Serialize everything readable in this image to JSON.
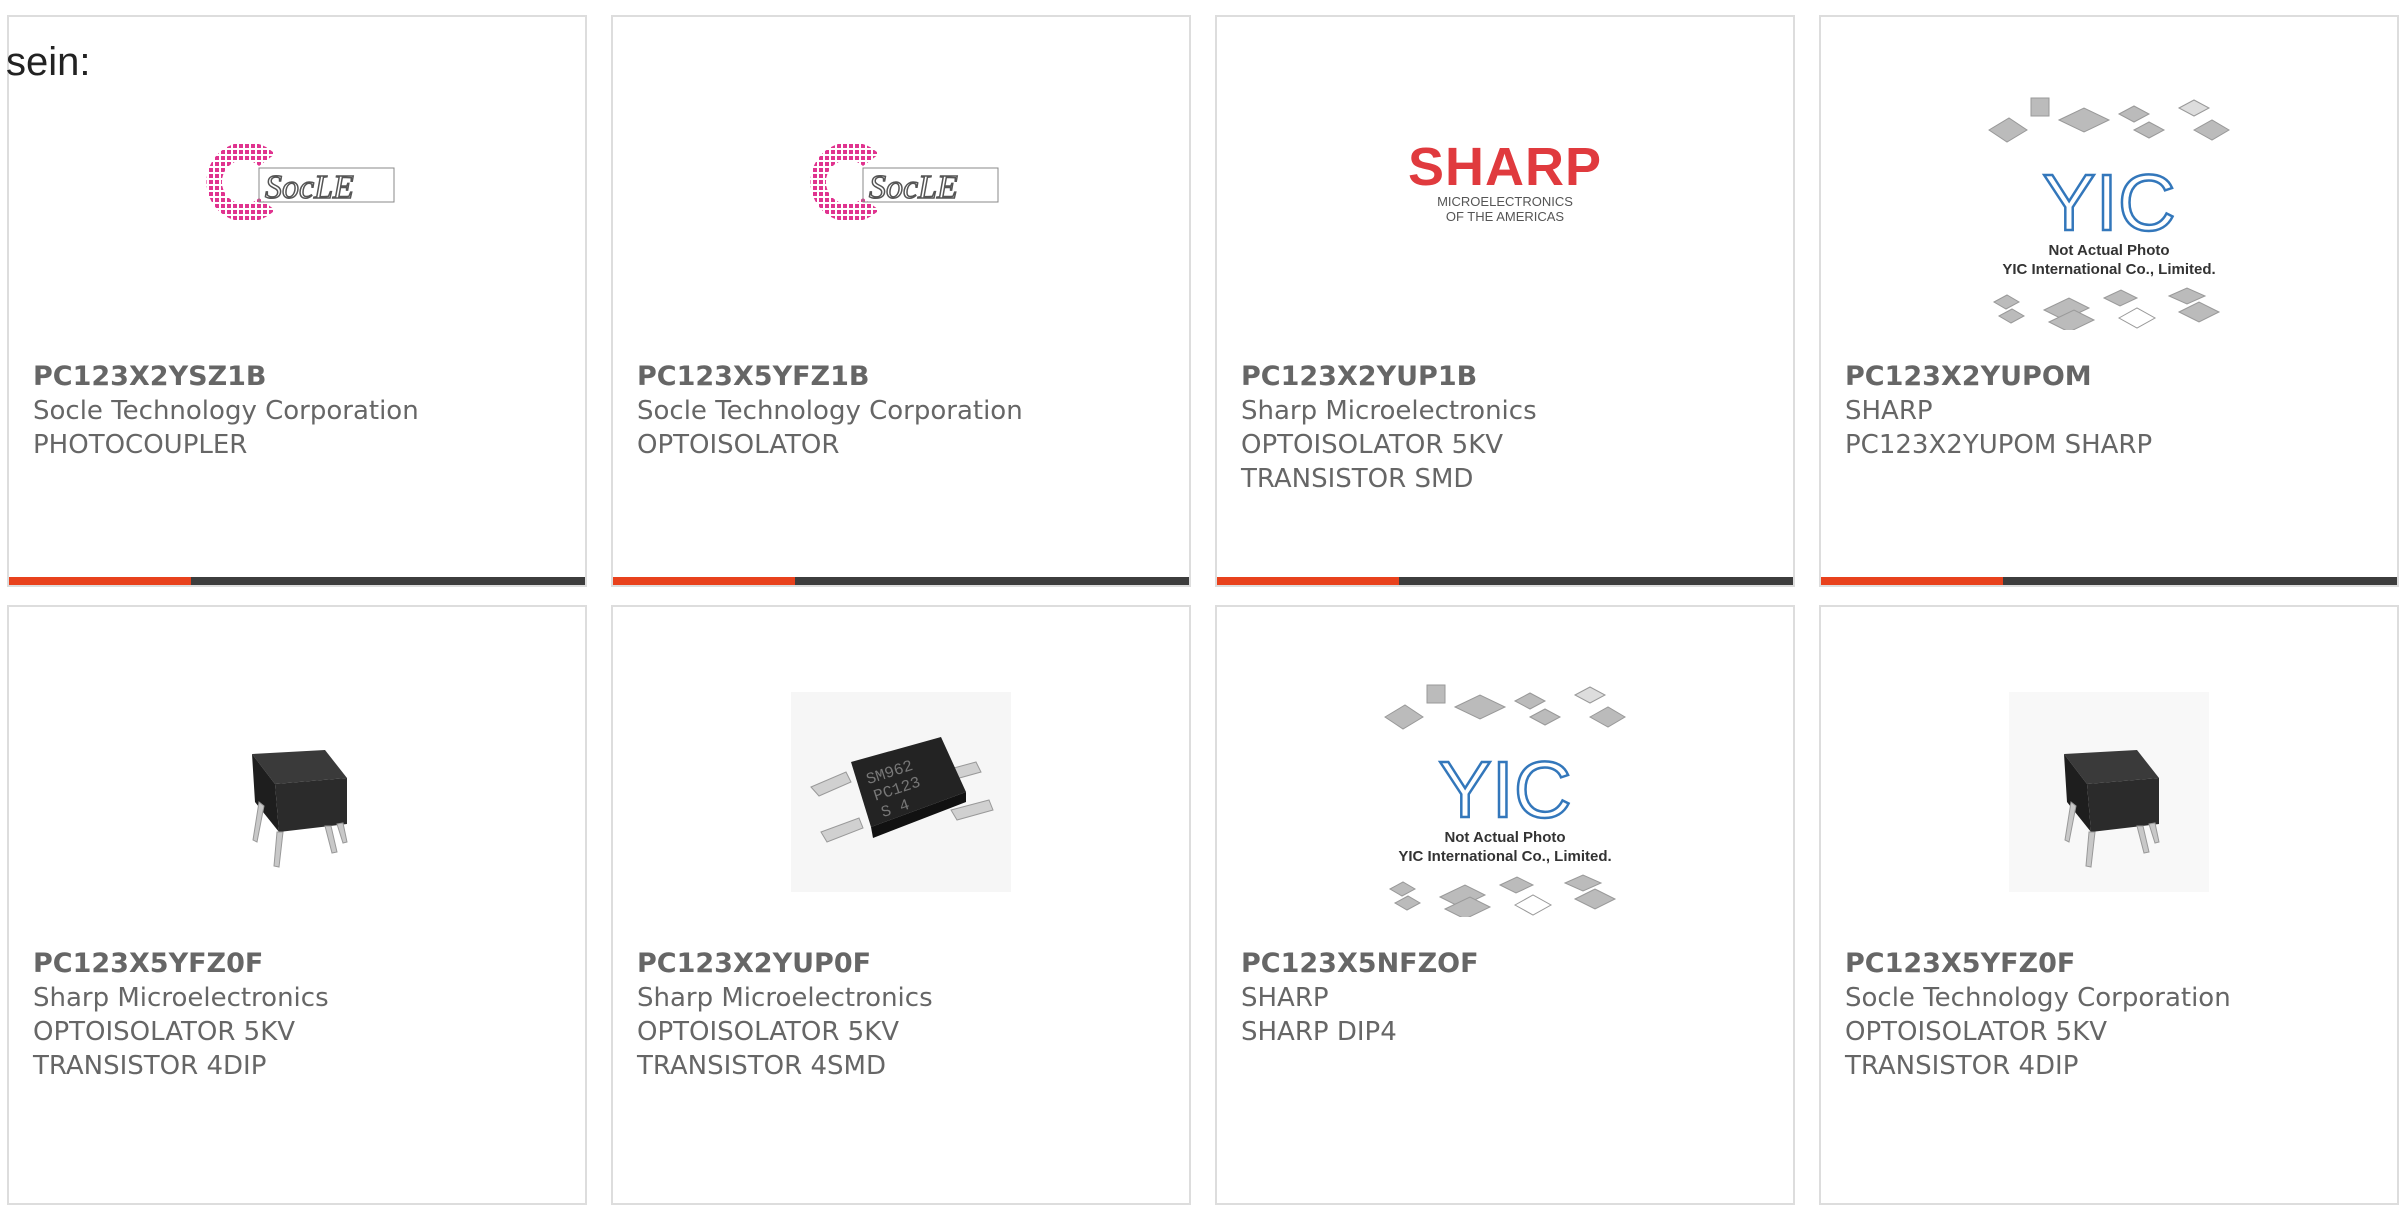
{
  "page": {
    "heading": "sein:"
  },
  "colors": {
    "accent": "#e8411c",
    "bar": "#3d3d3d",
    "border": "#dddddd",
    "sharp_red": "#e03a3e"
  },
  "cards": [
    {
      "part": "PC123X2YSZ1B",
      "maker": "Socle Technology Corporation",
      "desc1": "PHOTOCOUPLER",
      "desc2": "",
      "image": "socle-logo"
    },
    {
      "part": "PC123X5YFZ1B",
      "maker": "Socle Technology Corporation",
      "desc1": "OPTOISOLATOR",
      "desc2": "",
      "image": "socle-logo"
    },
    {
      "part": "PC123X2YUP1B",
      "maker": "Sharp Microelectronics",
      "desc1": "OPTOISOLATOR 5KV",
      "desc2": "TRANSISTOR SMD",
      "image": "sharp-logo"
    },
    {
      "part": "PC123X2YUPOM",
      "maker": "SHARP",
      "desc1": "PC123X2YUPOM SHARP",
      "desc2": "",
      "image": "yic-placeholder"
    },
    {
      "part": "PC123X5YFZ0F",
      "maker": "Sharp Microelectronics",
      "desc1": "OPTOISOLATOR 5KV",
      "desc2": "TRANSISTOR 4DIP",
      "image": "dip4-chip"
    },
    {
      "part": "PC123X2YUP0F",
      "maker": "Sharp Microelectronics",
      "desc1": "OPTOISOLATOR 5KV",
      "desc2": "TRANSISTOR 4SMD",
      "image": "smd4-chip"
    },
    {
      "part": "PC123X5NFZOF",
      "maker": "SHARP",
      "desc1": "SHARP DIP4",
      "desc2": "",
      "image": "yic-placeholder"
    },
    {
      "part": "PC123X5YFZ0F",
      "maker": "Socle Technology Corporation",
      "desc1": "OPTOISOLATOR 5KV",
      "desc2": "TRANSISTOR 4DIP",
      "image": "dip4-chip"
    }
  ],
  "logos": {
    "socle_text": "SocLE",
    "sharp_word": "SHARP",
    "sharp_sub1": "MICROELECTRONICS",
    "sharp_sub2": "OF THE AMERICAS",
    "yic_mark": "YIC",
    "yic_line1": "Not Actual Photo",
    "yic_line2": "YIC International Co., Limited.",
    "chip_marking1": "SM962",
    "chip_marking2": "PC123",
    "chip_marking3": "S 4"
  }
}
